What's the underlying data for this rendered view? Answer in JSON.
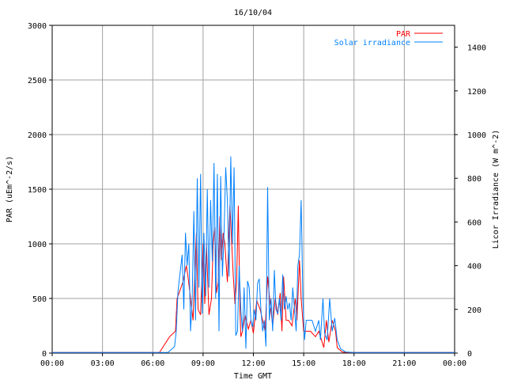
{
  "chart_data": {
    "type": "line",
    "title": "16/10/04",
    "xlabel": "Time GMT",
    "ylabel_left": "PAR (uEm^-2/s)",
    "ylabel_right": "Licor Irradiance (W m^-2)",
    "x_ticks": [
      "00:00",
      "03:00",
      "06:00",
      "09:00",
      "12:00",
      "15:00",
      "18:00",
      "21:00",
      "00:00"
    ],
    "xlim_hours": [
      0,
      24
    ],
    "ylim_left": [
      0,
      3000
    ],
    "y_ticks_left": [
      "0",
      "500",
      "1000",
      "1500",
      "2000",
      "2500",
      "3000"
    ],
    "ylim_right": [
      0,
      1500
    ],
    "y_ticks_right": [
      "0",
      "200",
      "400",
      "600",
      "800",
      "1000",
      "1200",
      "1400"
    ],
    "grid": true,
    "legend_position": "top-right",
    "series": [
      {
        "name": "PAR",
        "color": "#ff0000",
        "axis": "left",
        "x_hours": [
          0,
          6.4,
          7.0,
          7.35,
          7.45,
          7.8,
          8.0,
          8.1,
          8.25,
          8.4,
          8.6,
          8.7,
          8.85,
          9.0,
          9.1,
          9.2,
          9.35,
          9.5,
          9.6,
          9.7,
          9.8,
          9.9,
          10.0,
          10.1,
          10.2,
          10.3,
          10.45,
          10.6,
          10.8,
          10.9,
          11.0,
          11.1,
          11.2,
          11.25,
          11.35,
          11.5,
          11.7,
          11.85,
          12.0,
          12.2,
          12.4,
          12.55,
          12.7,
          12.85,
          13.0,
          13.15,
          13.3,
          13.45,
          13.6,
          13.7,
          13.8,
          13.95,
          14.1,
          14.3,
          14.5,
          14.6,
          14.75,
          14.85,
          15.0,
          15.4,
          15.7,
          15.9,
          16.1,
          16.2,
          16.35,
          16.5,
          16.7,
          16.9,
          17.0,
          17.3,
          17.6,
          18.0,
          24.0
        ],
        "values": [
          5,
          5,
          150,
          200,
          500,
          650,
          800,
          700,
          500,
          300,
          1100,
          400,
          350,
          1000,
          450,
          1000,
          350,
          500,
          1000,
          1150,
          550,
          650,
          1250,
          850,
          1100,
          1000,
          650,
          1350,
          700,
          450,
          650,
          1350,
          400,
          150,
          200,
          350,
          220,
          300,
          180,
          480,
          400,
          300,
          200,
          700,
          450,
          250,
          500,
          350,
          550,
          200,
          700,
          300,
          300,
          250,
          500,
          300,
          850,
          500,
          200,
          200,
          150,
          200,
          100,
          50,
          300,
          100,
          300,
          200,
          50,
          10,
          5,
          5,
          5
        ]
      },
      {
        "name": "Solar irradiance",
        "color": "#0080ff",
        "axis": "right",
        "x_hours": [
          0,
          6.9,
          7.3,
          7.4,
          7.5,
          7.6,
          7.75,
          7.85,
          7.95,
          8.05,
          8.15,
          8.25,
          8.35,
          8.45,
          8.55,
          8.65,
          8.75,
          8.85,
          8.95,
          9.05,
          9.15,
          9.25,
          9.35,
          9.45,
          9.55,
          9.65,
          9.75,
          9.85,
          9.95,
          10.05,
          10.15,
          10.25,
          10.35,
          10.45,
          10.55,
          10.65,
          10.75,
          10.85,
          10.95,
          11.05,
          11.15,
          11.25,
          11.35,
          11.45,
          11.55,
          11.65,
          11.75,
          11.85,
          11.95,
          12.05,
          12.15,
          12.25,
          12.35,
          12.45,
          12.55,
          12.65,
          12.75,
          12.85,
          12.95,
          13.05,
          13.15,
          13.25,
          13.35,
          13.45,
          13.55,
          13.65,
          13.75,
          13.85,
          13.95,
          14.05,
          14.15,
          14.25,
          14.35,
          14.45,
          14.55,
          14.65,
          14.75,
          14.85,
          14.95,
          15.05,
          15.15,
          15.3,
          15.5,
          15.7,
          15.9,
          16.0,
          16.15,
          16.25,
          16.4,
          16.55,
          16.7,
          16.85,
          17.0,
          17.2,
          17.5,
          18.0,
          24.0
        ],
        "values": [
          3,
          3,
          30,
          100,
          280,
          350,
          450,
          200,
          550,
          400,
          500,
          100,
          250,
          650,
          150,
          800,
          300,
          820,
          180,
          550,
          260,
          750,
          300,
          700,
          420,
          870,
          250,
          820,
          100,
          810,
          350,
          550,
          850,
          700,
          350,
          900,
          500,
          850,
          80,
          100,
          400,
          200,
          100,
          300,
          20,
          330,
          300,
          150,
          120,
          200,
          150,
          320,
          340,
          200,
          100,
          150,
          30,
          760,
          150,
          250,
          100,
          380,
          200,
          180,
          250,
          150,
          360,
          200,
          260,
          200,
          230,
          150,
          300,
          200,
          100,
          400,
          450,
          700,
          250,
          60,
          150,
          150,
          150,
          100,
          150,
          60,
          250,
          90,
          60,
          250,
          100,
          160,
          60,
          20,
          5,
          3,
          3
        ]
      }
    ]
  }
}
